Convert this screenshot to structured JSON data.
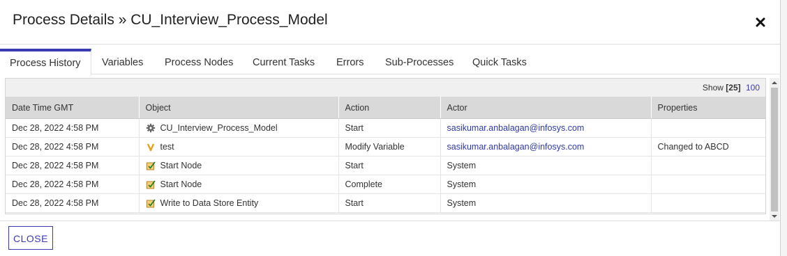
{
  "dialog": {
    "title": "Process Details » CU_Interview_Process_Model",
    "close_icon": "close-icon"
  },
  "tabs": [
    {
      "label": "Process History",
      "active": true
    },
    {
      "label": "Variables"
    },
    {
      "label": "Process Nodes"
    },
    {
      "label": "Current Tasks"
    },
    {
      "label": "Errors"
    },
    {
      "label": "Sub-Processes"
    },
    {
      "label": "Quick Tasks"
    }
  ],
  "pager": {
    "show_label": "Show",
    "current": "[25]",
    "other": "100"
  },
  "table": {
    "columns": [
      "Date Time GMT",
      "Object",
      "Action",
      "Actor",
      "Properties"
    ],
    "rows": [
      {
        "date": "Dec 28, 2022 4:58 PM",
        "icon": "gear-icon",
        "object": "CU_Interview_Process_Model",
        "action": "Start",
        "actor": "sasikumar.anbalagan@infosys.com",
        "properties": ""
      },
      {
        "date": "Dec 28, 2022 4:58 PM",
        "icon": "variable-icon",
        "object": "test",
        "action": "Modify Variable",
        "actor": "sasikumar.anbalagan@infosys.com",
        "properties": "Changed to ABCD"
      },
      {
        "date": "Dec 28, 2022 4:58 PM",
        "icon": "node-icon",
        "object": "Start Node",
        "action": "Start",
        "actor": "System",
        "properties": ""
      },
      {
        "date": "Dec 28, 2022 4:58 PM",
        "icon": "node-icon",
        "object": "Start Node",
        "action": "Complete",
        "actor": "System",
        "properties": ""
      },
      {
        "date": "Dec 28, 2022 4:58 PM",
        "icon": "node-icon",
        "object": "Write to Data Store Entity",
        "action": "Start",
        "actor": "System",
        "properties": ""
      }
    ]
  },
  "footer": {
    "close_label": "CLOSE"
  },
  "colors": {
    "accent": "#3a3ab3",
    "link": "#2f3aa8"
  }
}
